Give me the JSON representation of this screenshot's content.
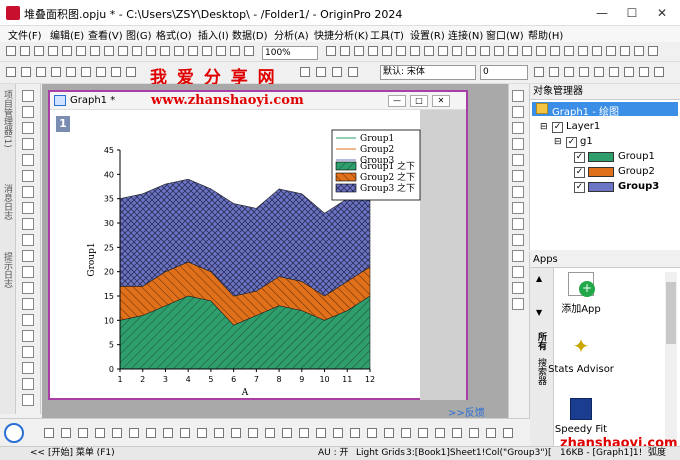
{
  "window": {
    "title": "堆叠面积图.opju * - C:\\Users\\ZSY\\Desktop\\ - /Folder1/ - OriginPro 2024",
    "minimize": "—",
    "maximize": "☐",
    "close": "✕"
  },
  "menu": [
    "文件(F)",
    "编辑(E)",
    "查看(V)",
    "图(G)",
    "格式(O)",
    "插入(I)",
    "数据(D)",
    "分析(A)",
    "快捷分析(K)",
    "工具(T)",
    "设置(R)",
    "连接(N)",
    "窗口(W)",
    "帮助(H)"
  ],
  "toolbar": {
    "zoom": "100%",
    "font": "默认: 宋体",
    "font_size": "0"
  },
  "watermark": {
    "cn": "我 爱 分 享 网",
    "url": "www.zhanshaoyi.com",
    "url_bottom": "zhanshaoyi.com"
  },
  "left_tabs": [
    "项目管理器(1)",
    "消息日志",
    "提示日志"
  ],
  "graph": {
    "title": "Graph1 *",
    "layer": "1",
    "feedback": ">>反馈"
  },
  "chart_data": {
    "type": "area",
    "x": [
      1,
      2,
      3,
      4,
      5,
      6,
      7,
      8,
      9,
      10,
      11,
      12
    ],
    "xlabel": "A",
    "ylabel": "Group1",
    "xlim": [
      1,
      12
    ],
    "ylim": [
      0,
      45
    ],
    "xticks": [
      1,
      2,
      3,
      4,
      5,
      6,
      7,
      8,
      9,
      10,
      11,
      12
    ],
    "yticks": [
      0,
      5,
      10,
      15,
      20,
      25,
      30,
      35,
      40,
      45
    ],
    "stacked": true,
    "series": [
      {
        "name": "Group1",
        "fill_label": "Group1 之下",
        "color": "#2e9e6c",
        "cumulative": [
          10,
          11,
          13,
          15,
          14,
          9,
          11,
          13,
          12,
          10,
          12,
          15
        ]
      },
      {
        "name": "Group2",
        "fill_label": "Group2 之下",
        "color": "#e0701a",
        "cumulative": [
          17,
          17,
          20,
          22,
          20,
          15,
          16,
          19,
          18,
          15,
          18,
          21
        ]
      },
      {
        "name": "Group3",
        "fill_label": "Group3 之下",
        "color": "#6c74c4",
        "cumulative": [
          35,
          36,
          38,
          39,
          37,
          34,
          33,
          37,
          36,
          32,
          35,
          36
        ]
      }
    ],
    "legend_position": "top-right"
  },
  "object_manager": {
    "title": "对象管理器",
    "graph": "Graph1 - 绘图",
    "layer": "Layer1",
    "group": "g1",
    "items": [
      "Group1",
      "Group2",
      "Group3"
    ]
  },
  "apps": {
    "title": "Apps",
    "side_tabs": [
      "所有",
      "搜索器"
    ],
    "items": [
      "添加App",
      "Stats Advisor",
      "Speedy Fit"
    ]
  },
  "status": {
    "start": "<<  [开始] 菜单 (F1)",
    "au": "AU : 开",
    "grids": "Light Grids",
    "cell": "3:[Book1]Sheet1!Col(\"Group3\")[1:12]",
    "size": "16KB - [Graph1]1!",
    "unit": "弧度"
  },
  "colors": {
    "frame": "#a93ea6",
    "selection": "#3a8ee6",
    "watermark": "#e00000"
  }
}
